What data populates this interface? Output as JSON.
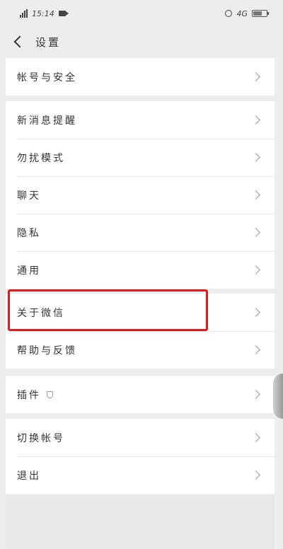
{
  "status_bar": {
    "time": "15:14",
    "network": "4G"
  },
  "nav": {
    "title": "设置"
  },
  "groups": [
    {
      "items": [
        {
          "label": "帐号与安全"
        }
      ]
    },
    {
      "items": [
        {
          "label": "新消息提醒"
        },
        {
          "label": "勿扰模式"
        },
        {
          "label": "聊天"
        },
        {
          "label": "隐私"
        },
        {
          "label": "通用"
        }
      ]
    },
    {
      "items": [
        {
          "label": "关于微信"
        },
        {
          "label": "帮助与反馈"
        }
      ]
    },
    {
      "items": [
        {
          "label": "插件"
        }
      ]
    },
    {
      "items": [
        {
          "label": "切换帐号"
        },
        {
          "label": "退出"
        }
      ]
    }
  ],
  "highlight_color": "#e01b1b"
}
